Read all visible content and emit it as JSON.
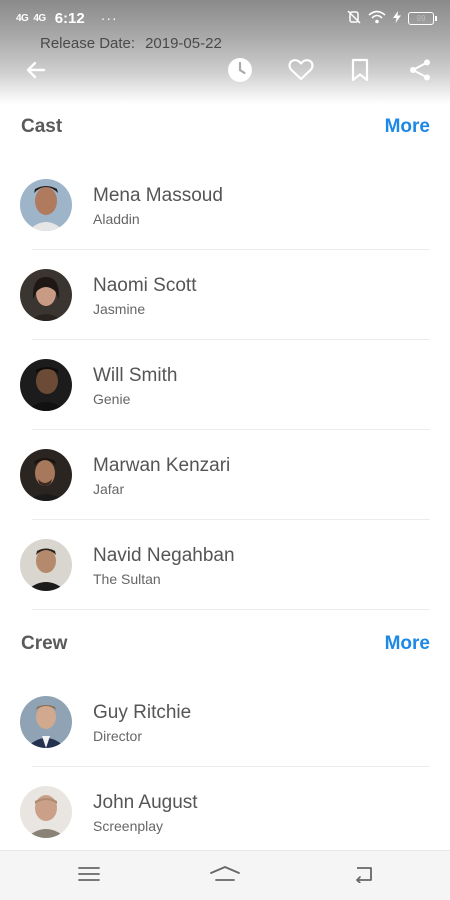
{
  "status_bar": {
    "signal1": "4G",
    "signal2": "4G",
    "time": "6:12",
    "dots": "···",
    "battery": "99"
  },
  "release": {
    "label": "Release Date:",
    "value": "2019-05-22"
  },
  "appbar": {
    "icons": [
      "back-arrow-icon",
      "clock-icon",
      "heart-icon",
      "bookmark-icon",
      "share-icon"
    ]
  },
  "cast": {
    "title": "Cast",
    "more": "More",
    "members": [
      {
        "name": "Mena Massoud",
        "role": "Aladdin"
      },
      {
        "name": "Naomi Scott",
        "role": "Jasmine"
      },
      {
        "name": "Will Smith",
        "role": "Genie"
      },
      {
        "name": "Marwan Kenzari",
        "role": "Jafar"
      },
      {
        "name": "Navid Negahban",
        "role": "The Sultan"
      }
    ]
  },
  "crew": {
    "title": "Crew",
    "more": "More",
    "members": [
      {
        "name": "Guy Ritchie",
        "role": "Director"
      },
      {
        "name": "John August",
        "role": "Screenplay"
      }
    ]
  },
  "colors": {
    "accent": "#1e88e5",
    "text": "#555555",
    "navbar": "#f5f5f5"
  },
  "navbar": {
    "icons": [
      "menu-icon",
      "home-icon",
      "back-icon"
    ]
  }
}
